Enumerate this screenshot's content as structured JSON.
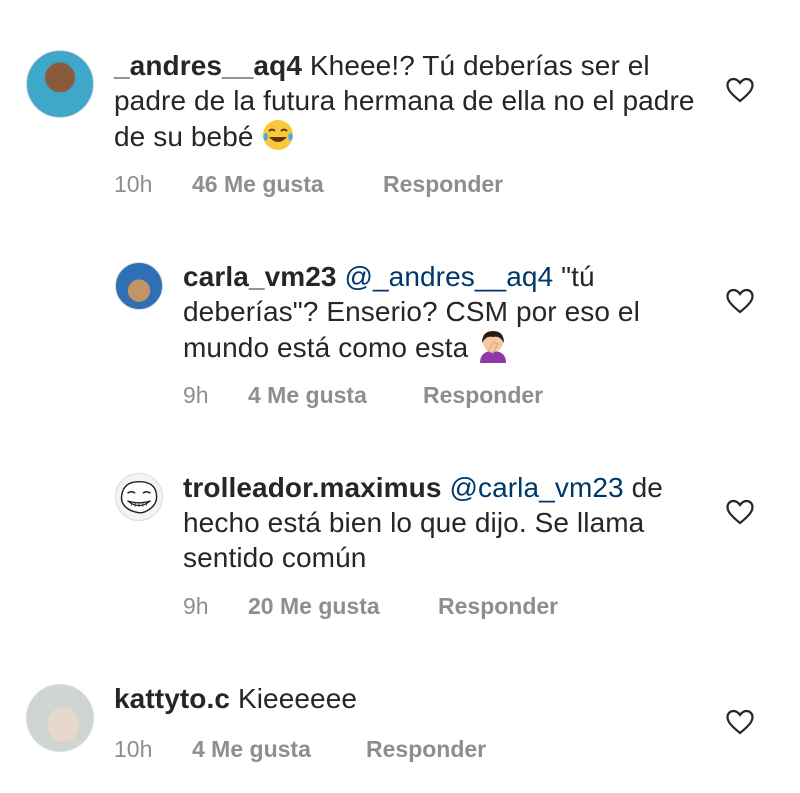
{
  "comments": [
    {
      "username": "_andres__aq4",
      "text": "Kheee!? Tú deberías ser el padre de la futura hermana de ella no el padre de su bebé",
      "emoji": "tears-of-joy-emoji",
      "time": "10h",
      "likes": "46 Me gusta",
      "reply": "Responder"
    },
    {
      "username": "carla_vm23",
      "mention": "@_andres__aq4",
      "text": "\"tú deberías\"? Enserio? CSM por eso el mundo está como esta",
      "emoji": "facepalm-woman-emoji",
      "time": "9h",
      "likes": "4 Me gusta",
      "reply": "Responder"
    },
    {
      "username": "trolleador.maximus",
      "mention": "@carla_vm23",
      "text": "de hecho está bien  lo que dijo. Se llama sentido común",
      "time": "9h",
      "likes": "20 Me gusta",
      "reply": "Responder"
    },
    {
      "username": "kattyto.c",
      "text": "Kieeeeee",
      "time": "10h",
      "likes": "4 Me gusta",
      "reply": "Responder"
    }
  ]
}
